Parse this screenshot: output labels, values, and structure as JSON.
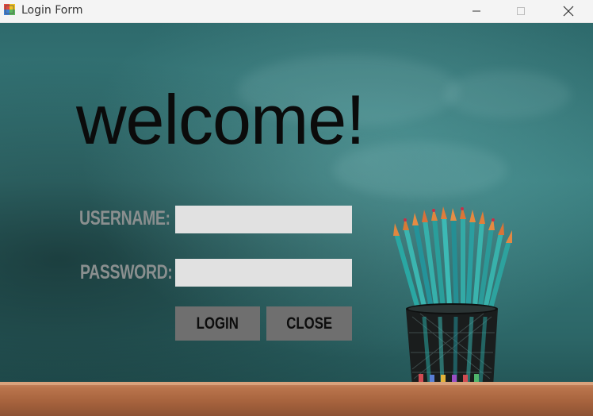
{
  "window": {
    "title": "Login Form",
    "minimize_glyph": "─",
    "close_glyph": "✕"
  },
  "form": {
    "heading": "welcome!",
    "username_label": "USERNAME:",
    "password_label": "PASSWORD:",
    "username_value": "",
    "password_value": "",
    "login_label": "LOGIN",
    "close_label": "CLOSE"
  },
  "colors": {
    "chalkboard": "#3a7f80",
    "field_bg": "#e1e1e1",
    "button_bg": "#6f6f6f",
    "label_color": "#8a8f8f",
    "desk": "#b9744c"
  }
}
